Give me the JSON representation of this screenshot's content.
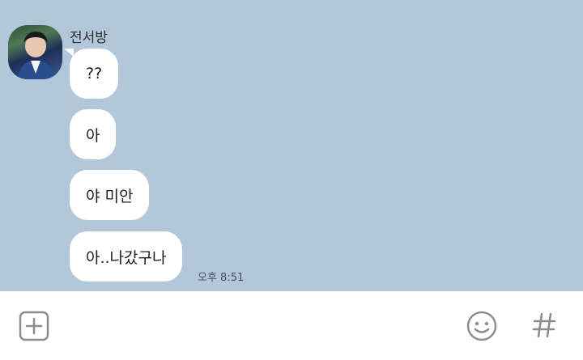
{
  "conversation": {
    "sender_name": "전서방",
    "messages": [
      {
        "text": "??"
      },
      {
        "text": "아"
      },
      {
        "text": "야 미안"
      },
      {
        "text": "아..나갔구나"
      }
    ],
    "last_timestamp": "오후 8:51"
  },
  "input_bar": {
    "left_icon": "plus-icon",
    "right_icons": [
      "emoji-icon",
      "hashtag-icon"
    ]
  },
  "colors": {
    "chat_background": "#b2c7da",
    "bubble": "#ffffff",
    "icon_gray": "#8e8e8e"
  }
}
